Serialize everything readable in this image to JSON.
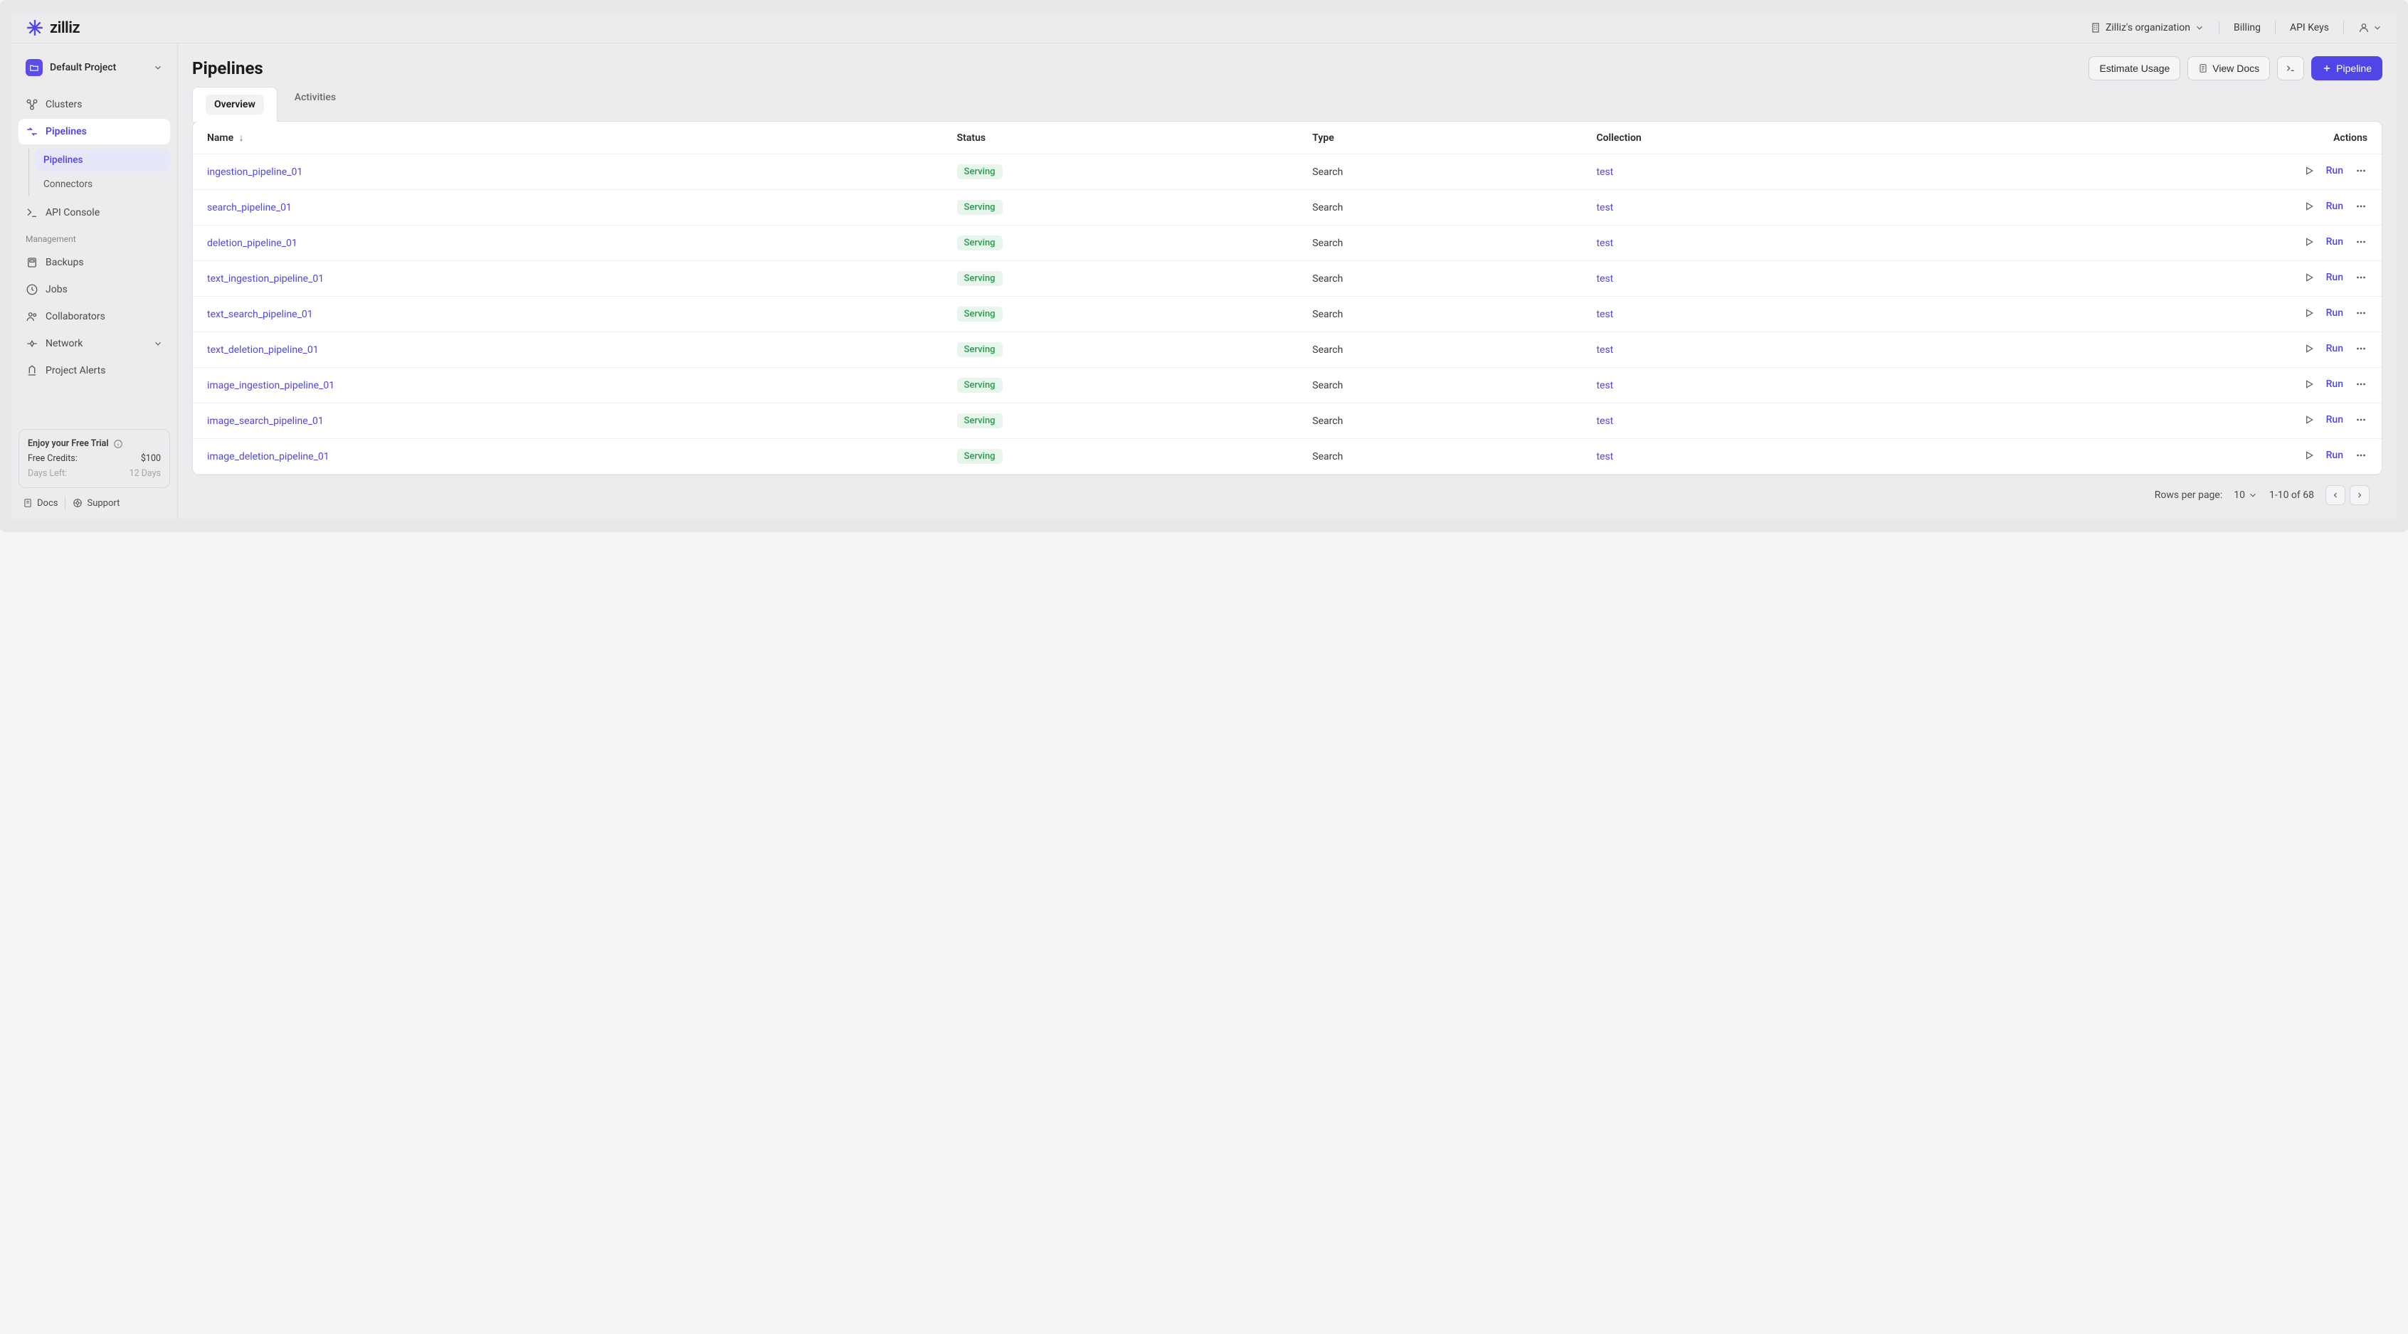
{
  "brand": "zilliz",
  "header": {
    "org_label": "Zilliz's organization",
    "billing": "Billing",
    "api_keys": "API Keys"
  },
  "sidebar": {
    "project": "Default Project",
    "nav": {
      "clusters": "Clusters",
      "pipelines": "Pipelines",
      "pipelines_sub": "Pipelines",
      "connectors": "Connectors",
      "api_console": "API Console"
    },
    "management_label": "Management",
    "management": {
      "backups": "Backups",
      "jobs": "Jobs",
      "collaborators": "Collaborators",
      "network": "Network",
      "alerts": "Project Alerts"
    },
    "trial": {
      "title": "Enjoy your Free Trial",
      "credits_label": "Free Credits:",
      "credits_value": "$100",
      "days_label": "Days Left:",
      "days_value": "12 Days"
    },
    "footer": {
      "docs": "Docs",
      "support": "Support"
    }
  },
  "page": {
    "title": "Pipelines",
    "estimate": "Estimate Usage",
    "view_docs": "View Docs",
    "pipeline": "Pipeline"
  },
  "tabs": {
    "overview": "Overview",
    "activities": "Activities"
  },
  "table": {
    "headers": {
      "name": "Name",
      "status": "Status",
      "type": "Type",
      "collection": "Collection",
      "actions": "Actions"
    },
    "run_label": "Run",
    "rows": [
      {
        "name": "ingestion_pipeline_01",
        "status": "Serving",
        "type": "Search",
        "collection": "test"
      },
      {
        "name": "search_pipeline_01",
        "status": "Serving",
        "type": "Search",
        "collection": "test"
      },
      {
        "name": "deletion_pipeline_01",
        "status": "Serving",
        "type": "Search",
        "collection": "test"
      },
      {
        "name": "text_ingestion_pipeline_01",
        "status": "Serving",
        "type": "Search",
        "collection": "test"
      },
      {
        "name": "text_search_pipeline_01",
        "status": "Serving",
        "type": "Search",
        "collection": "test"
      },
      {
        "name": "text_deletion_pipeline_01",
        "status": "Serving",
        "type": "Search",
        "collection": "test"
      },
      {
        "name": "image_ingestion_pipeline_01",
        "status": "Serving",
        "type": "Search",
        "collection": "test"
      },
      {
        "name": "image_search_pipeline_01",
        "status": "Serving",
        "type": "Search",
        "collection": "test"
      },
      {
        "name": "image_deletion_pipeline_01",
        "status": "Serving",
        "type": "Search",
        "collection": "test"
      }
    ]
  },
  "pagination": {
    "rows_label": "Rows per page:",
    "page_size": "10",
    "range": "1-10 of 68"
  }
}
